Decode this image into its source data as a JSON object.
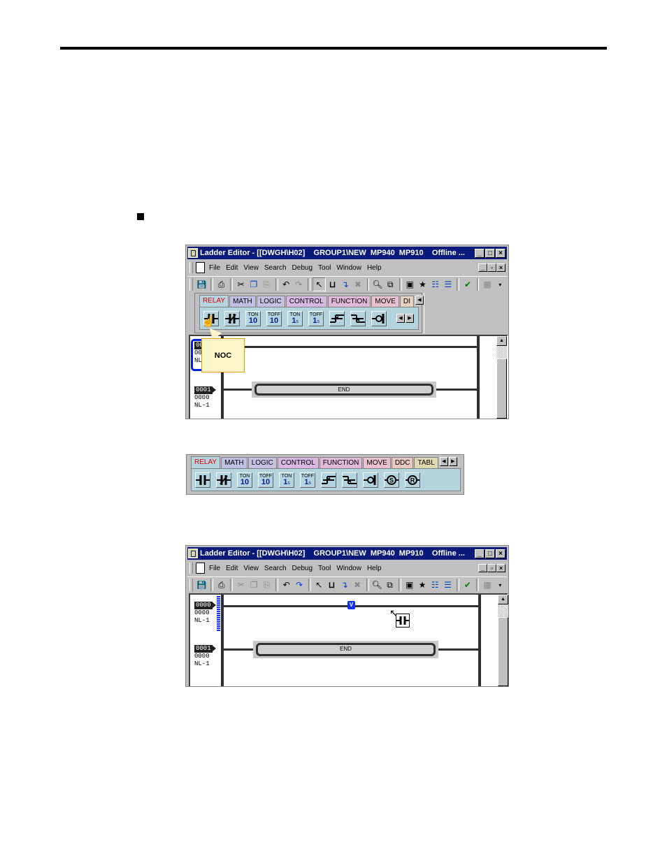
{
  "page": {
    "section_bullet": "■"
  },
  "window1": {
    "title": "Ladder Editor - [[DWGH\\H02]    GROUP1\\NEW  MP940  MP910    Offline ...",
    "title_buttons": [
      "_",
      "□",
      "×"
    ],
    "menu": [
      "File",
      "Edit",
      "View",
      "Search",
      "Debug",
      "Tool",
      "Window",
      "Help"
    ],
    "mdi_buttons": [
      "_",
      "▫",
      "×"
    ],
    "toolbar_icons": [
      "save-icon",
      "print-icon",
      "cut-icon",
      "copy-icon",
      "paste-icon",
      "undo-icon",
      "redo-icon",
      "pointer-icon",
      "insert-rung-icon",
      "insert-branch-icon",
      "delete-icon",
      "find-icon",
      "zoom-icon",
      "register-list-icon",
      "bookmark-icon",
      "list-view-icon",
      "tree-view-icon",
      "check-icon",
      "disabled-icon",
      "dropdown-arrow-icon"
    ],
    "palette": {
      "tabs": [
        "RELAY",
        "MATH",
        "LOGIC",
        "CONTROL",
        "FUNCTION",
        "MOVE",
        "DI"
      ],
      "active_tab": "RELAY",
      "tab_colors": [
        "#b4d4e0",
        "#c0c0e4",
        "#c8c0e0",
        "#d8b8e0",
        "#e0b8d8",
        "#e8c0d0",
        "#e8d0c0"
      ],
      "tools": [
        {
          "name": "noc-contact",
          "type": "noc"
        },
        {
          "name": "ncc-contact",
          "type": "ncc"
        },
        {
          "name": "ton-10ms",
          "top": "TON",
          "bottom": "10",
          "unit": ""
        },
        {
          "name": "toff-10ms",
          "top": "TOFF",
          "bottom": "10",
          "unit": ""
        },
        {
          "name": "ton-1s",
          "top": "TON",
          "bottom": "1",
          "unit": "s"
        },
        {
          "name": "toff-1s",
          "top": "TOFF",
          "bottom": "1",
          "unit": "s"
        },
        {
          "name": "rising-edge",
          "type": "on-pulse"
        },
        {
          "name": "falling-edge",
          "type": "off-pulse"
        },
        {
          "name": "coil",
          "type": "coil"
        }
      ]
    },
    "tooltip": "NOC",
    "rungs": [
      {
        "number": "0000",
        "step": "0000",
        "label": "NL-1"
      },
      {
        "number": "0001",
        "step": "0000",
        "label": "NL-1",
        "instruction": "END"
      }
    ]
  },
  "palette2": {
    "tabs": [
      "RELAY",
      "MATH",
      "LOGIC",
      "CONTROL",
      "FUNCTION",
      "MOVE",
      "DDC",
      "TABL"
    ],
    "active_tab": "RELAY",
    "tab_colors": [
      "#b4d4e0",
      "#c0c0e4",
      "#c8c0e0",
      "#d8b8e0",
      "#e0b8d8",
      "#e8c0d0",
      "#e8c8c0",
      "#e0d8b0"
    ],
    "tools": [
      {
        "name": "noc-contact",
        "type": "noc"
      },
      {
        "name": "ncc-contact",
        "type": "ncc"
      },
      {
        "name": "ton-10ms",
        "top": "TON",
        "bottom": "10",
        "unit": ""
      },
      {
        "name": "toff-10ms",
        "top": "TOFF",
        "bottom": "10",
        "unit": ""
      },
      {
        "name": "ton-1s",
        "top": "TON",
        "bottom": "1",
        "unit": "s"
      },
      {
        "name": "toff-1s",
        "top": "TOFF",
        "bottom": "1",
        "unit": "s"
      },
      {
        "name": "rising-edge",
        "type": "on-pulse"
      },
      {
        "name": "falling-edge",
        "type": "off-pulse"
      },
      {
        "name": "coil",
        "type": "coil"
      },
      {
        "name": "set-coil",
        "type": "set",
        "letter": "S"
      },
      {
        "name": "reset-coil",
        "type": "reset",
        "letter": "R"
      }
    ]
  },
  "window2": {
    "title": "Ladder Editor - [[DWGH\\H02]    GROUP1\\NEW  MP940  MP910    Offline ...",
    "title_buttons": [
      "_",
      "□",
      "×"
    ],
    "menu": [
      "File",
      "Edit",
      "View",
      "Search",
      "Debug",
      "Tool",
      "Window",
      "Help"
    ],
    "mdi_buttons": [
      "_",
      "▫",
      "×"
    ],
    "insert_marker": "V",
    "rungs": [
      {
        "number": "0000",
        "step": "0000",
        "label": "NL-1"
      },
      {
        "number": "0001",
        "step": "0000",
        "label": "NL-1",
        "instruction": "END"
      }
    ]
  }
}
